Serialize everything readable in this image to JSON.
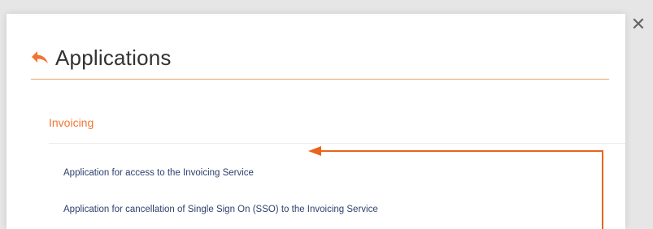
{
  "header": {
    "title": "Applications",
    "back_icon": "back-arrow-icon",
    "close_icon": "close-icon",
    "close_glyph": "✕",
    "accent_color": "#f07532"
  },
  "section": {
    "title": "Invoicing",
    "items": [
      {
        "label": "Application for access to the Invoicing Service"
      },
      {
        "label": "Application for cancellation of Single Sign On (SSO) to the Invoicing Service"
      }
    ]
  },
  "annotation": {
    "type": "arrow",
    "color": "#e8651c",
    "target": "Application for access to the Invoicing Service"
  }
}
